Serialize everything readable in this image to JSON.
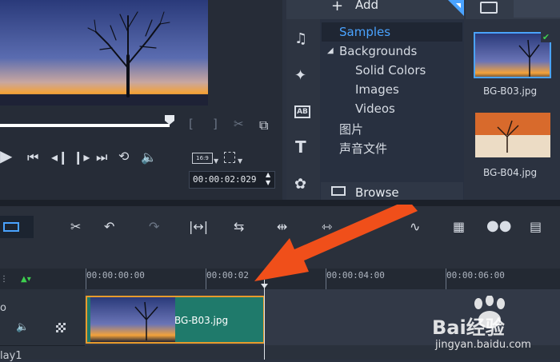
{
  "preview": {
    "timecode": "00:00:02:029",
    "aspect_label": "16:9"
  },
  "library": {
    "add_label": "Add",
    "tree": {
      "samples": "Samples",
      "backgrounds": "Backgrounds",
      "solid_colors": "Solid Colors",
      "images": "Images",
      "videos": "Videos",
      "pictures_cn": "图片",
      "audio_cn": "声音文件"
    },
    "browse_label": "Browse",
    "thumbnails": [
      {
        "label": "BG-B03.jpg"
      },
      {
        "label": "BG-B04.jpg"
      }
    ]
  },
  "timeline": {
    "ruler": [
      "00:00:00:00",
      "00:00:02",
      "00:00:04:00",
      "00:00:06:00"
    ],
    "track_labels": [
      "o",
      "lay1"
    ],
    "clip_label": "BG-B03.jpg"
  },
  "watermark": {
    "brand": "Bai经验",
    "url": "jingyan.baidu.com"
  },
  "colors": {
    "accent_blue": "#4aa3ff",
    "clip_green": "#1f7a6b",
    "clip_border": "#e89b2c",
    "arrow_orange": "#f04f1a",
    "check_green": "#3ecf4f"
  }
}
